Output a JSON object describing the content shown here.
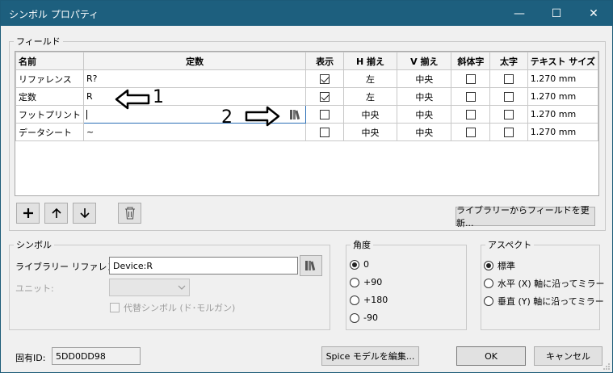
{
  "window": {
    "title": "シンボル プロパティ",
    "minimize": "—",
    "maximize": "☐",
    "close": "✕"
  },
  "fields_group": {
    "label": "フィールド",
    "columns": [
      "名前",
      "定数",
      "表示",
      "H 揃え",
      "V 揃え",
      "斜体字",
      "太字",
      "テキスト サイズ"
    ],
    "rows": [
      {
        "name": "リファレンス",
        "value": "R?",
        "show": true,
        "h_align": "左",
        "v_align": "中央",
        "italic": false,
        "bold": false,
        "size": "1.270 mm"
      },
      {
        "name": "定数",
        "value": "R",
        "show": true,
        "h_align": "左",
        "v_align": "中央",
        "italic": false,
        "bold": false,
        "size": "1.270 mm"
      },
      {
        "name": "フットプリント",
        "value": "",
        "show": false,
        "h_align": "中央",
        "v_align": "中央",
        "italic": false,
        "bold": false,
        "size": "1.270 mm"
      },
      {
        "name": "データシート",
        "value": "~",
        "show": false,
        "h_align": "中央",
        "v_align": "中央",
        "italic": false,
        "bold": false,
        "size": "1.270 mm"
      }
    ],
    "update_button": "ライブラリーからフィールドを更新..."
  },
  "annotations": {
    "arrow1_label": "1",
    "arrow2_label": "2"
  },
  "symbol_group": {
    "label": "シンボル",
    "lib_ref_label": "ライブラリー リファレンス:",
    "lib_ref_value": "Device:R",
    "unit_label": "ユニット:",
    "demorgan_label": "代替シンボル (ド･モルガン)"
  },
  "angle_group": {
    "label": "角度",
    "options": [
      "0",
      "+90",
      "+180",
      "-90"
    ],
    "selected": 0
  },
  "aspect_group": {
    "label": "アスペクト",
    "options": [
      "標準",
      "水平 (X) 軸に沿ってミラー",
      "垂直 (Y) 軸に沿ってミラー"
    ],
    "selected": 0
  },
  "footer": {
    "uid_label": "固有ID:",
    "uid_value": "5DD0DD98",
    "spice_button": "Spice モデルを編集...",
    "ok_button": "OK",
    "cancel_button": "キャンセル"
  }
}
